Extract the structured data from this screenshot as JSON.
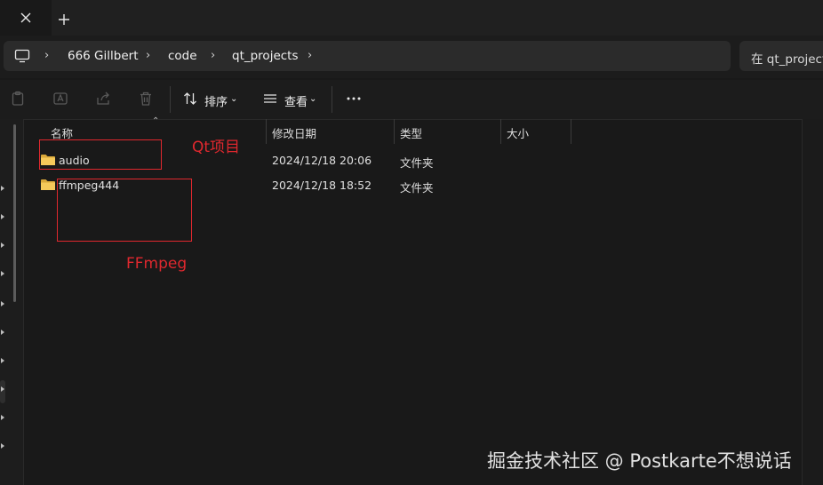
{
  "address": {
    "crumbs": [
      "666 Gillbert",
      "code",
      "qt_projects"
    ],
    "search_placeholder": "在 qt_project"
  },
  "toolbar": {
    "sort_label": "排序",
    "view_label": "查看"
  },
  "columns": {
    "name": "名称",
    "modified": "修改日期",
    "type": "类型",
    "size": "大小"
  },
  "files": [
    {
      "name": "audio",
      "modified": "2024/12/18 20:06",
      "type": "文件夹"
    },
    {
      "name": "ffmpeg444",
      "modified": "2024/12/18 18:52",
      "type": "文件夹"
    }
  ],
  "annotations": {
    "qt_label": "Qt项目",
    "ffmpeg_label": "FFmpeg",
    "color": "#e0282e"
  },
  "watermark": "掘金技术社区 @ Postkarte不想说话",
  "icons": {
    "close": "close-icon",
    "new_tab": "plus-icon",
    "pc": "computer-icon",
    "clipboard": "clipboard-icon",
    "rename": "rename-icon",
    "share": "share-icon",
    "delete": "trash-icon",
    "sort": "sort-icon",
    "view": "view-icon",
    "more": "more-icon",
    "folder": "folder-icon"
  },
  "colors": {
    "background": "#191919",
    "folder": "#f2c14e",
    "annotation": "#e0282e"
  }
}
